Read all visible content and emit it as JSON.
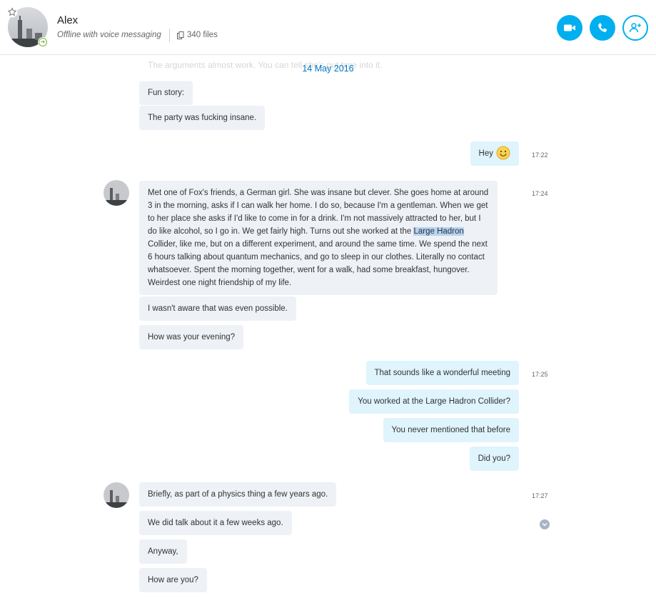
{
  "header": {
    "contact_name": "Alex",
    "status_text": "Offline with voice messaging",
    "files_count": "340 files",
    "status_color": "#7cb342",
    "accent": "#00aff0"
  },
  "conversation": {
    "faded_previous": "The arguments almost work. You can tell she's put time into it.",
    "date": "14 May 2016",
    "messages": [
      {
        "dir": "in",
        "text": "Fun story:"
      },
      {
        "dir": "in",
        "text": "The party was fucking insane."
      },
      {
        "dir": "out",
        "text": "Hey",
        "emoji": "smile-emoji",
        "time": "17:22"
      },
      {
        "dir": "in",
        "text_before": "Met one of Fox's friends, a German girl. She was insane but clever. She goes home at around 3 in the morning, asks if I can walk her home. I do so, because I'm a gentleman. When we get to her place she asks if I'd like to come in for a drink. I'm not massively attracted to her, but I do like alcohol, so I go in. We get fairly high. Turns out she worked at the ",
        "text_highlight": "Large Hadron",
        "text_after": " Collider, like me, but on a different experiment, and around the same time. We spend the next 6 hours talking about quantum mechanics, and go to sleep in our clothes. Literally no contact whatsoever. Spent the morning together, went for a walk, had some breakfast, hungover. Weirdest one night friendship of my life.",
        "time": "17:24"
      },
      {
        "dir": "in",
        "text": "I wasn't aware that was even possible."
      },
      {
        "dir": "in",
        "text": "How was your evening?"
      },
      {
        "dir": "out",
        "text": "That sounds like a wonderful meeting",
        "time": "17:25"
      },
      {
        "dir": "out",
        "text": "You worked at the Large Hadron Collider?"
      },
      {
        "dir": "out",
        "text": "You never mentioned that before"
      },
      {
        "dir": "out",
        "text": "Did you?"
      },
      {
        "dir": "in",
        "text": "Briefly, as part of a physics thing a few years ago.",
        "time": "17:27"
      },
      {
        "dir": "in",
        "text": "We did talk about it a few weeks ago."
      },
      {
        "dir": "in",
        "text": "Anyway,"
      },
      {
        "dir": "in",
        "text": "How are you?"
      }
    ]
  },
  "colors": {
    "incoming_bubble": "#eef1f6",
    "outgoing_bubble": "#dff4fd",
    "date_text": "#0078c8",
    "highlight": "#b5d4f5"
  }
}
